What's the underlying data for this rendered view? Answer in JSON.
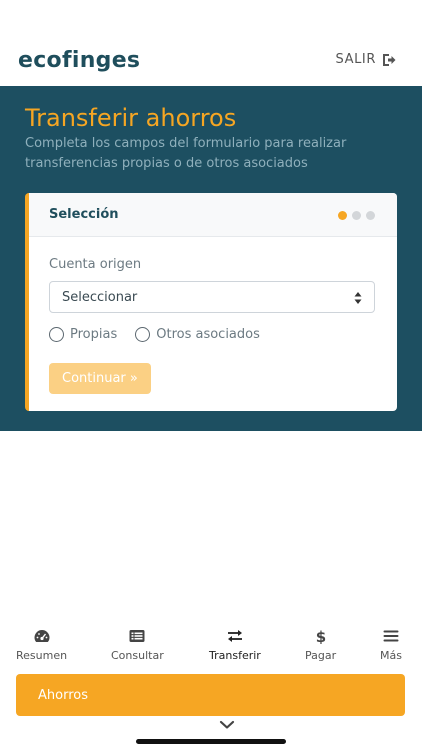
{
  "header": {
    "logo_text": "ecofinges",
    "logout_label": "SALIR",
    "logout_icon": "sign-out-icon"
  },
  "hero": {
    "title": "Transferir ahorros",
    "subtitle": "Completa los campos del formulario para realizar transferencias propias o de otros asociados"
  },
  "card": {
    "title": "Selección",
    "steps_total": 3,
    "step_current": 1,
    "origin_label": "Cuenta origen",
    "origin_select_value": "Seleccionar",
    "radio_options": [
      "Propias",
      "Otros asociados"
    ],
    "continue_label": "Continuar »"
  },
  "tabbar": {
    "items": [
      {
        "label": "Resumen",
        "icon": "gauge-icon"
      },
      {
        "label": "Consultar",
        "icon": "list-alt-icon"
      },
      {
        "label": "Transferir",
        "icon": "exchange-icon",
        "active": true
      },
      {
        "label": "Pagar",
        "icon": "dollar-icon"
      },
      {
        "label": "Más",
        "icon": "menu-icon"
      }
    ]
  },
  "bottom_button": {
    "label": "Ahorros"
  },
  "colors": {
    "accent": "#f6a623",
    "hero_bg": "#1d4f61",
    "brand_text": "#1f4e5c"
  }
}
